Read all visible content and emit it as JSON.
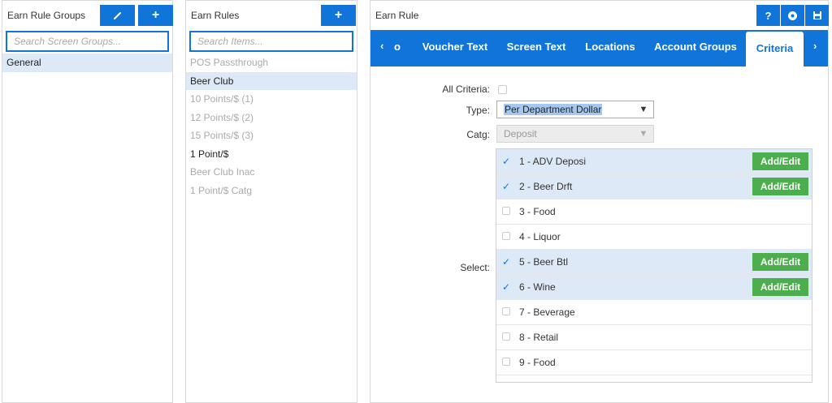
{
  "groups_panel": {
    "title": "Earn Rule Groups",
    "edit_icon": "pencil-icon",
    "add_icon": "plus-icon",
    "search_placeholder": "Search Screen Groups...",
    "items": [
      {
        "label": "General",
        "state": "selected"
      }
    ]
  },
  "rules_panel": {
    "title": "Earn Rules",
    "add_icon": "plus-icon",
    "search_placeholder": "Search Items...",
    "items": [
      {
        "label": "POS Passthrough",
        "state": "inactive"
      },
      {
        "label": "Beer Club",
        "state": "selected"
      },
      {
        "label": "10 Points/$ (1)",
        "state": "inactive"
      },
      {
        "label": "12 Points/$ (2)",
        "state": "inactive"
      },
      {
        "label": "15 Points/$ (3)",
        "state": "inactive"
      },
      {
        "label": "1 Point/$",
        "state": "active"
      },
      {
        "label": "Beer Club Inac",
        "state": "inactive"
      },
      {
        "label": "1 Point/$ Catg",
        "state": "inactive"
      }
    ]
  },
  "earn_rule": {
    "title": "Earn Rule",
    "header_icons": [
      "help-icon",
      "save-disk-icon",
      "save-icon"
    ],
    "help_label": "?",
    "tabs": {
      "partial": "o",
      "voucher_text": "Voucher Text",
      "screen_text": "Screen Text",
      "locations": "Locations",
      "account_groups": "Account Groups",
      "criteria": "Criteria"
    },
    "active_tab": "Criteria",
    "criteria": {
      "all_criteria_label": "All Criteria:",
      "all_criteria_checked": false,
      "type_label": "Type:",
      "type_value": "Per Department Dollar",
      "catg_label": "Catg:",
      "catg_value": "Deposit",
      "select_label": "Select:",
      "add_edit_label": "Add/Edit",
      "items": [
        {
          "label": "1 - ADV Deposi",
          "checked": true
        },
        {
          "label": "2 - Beer Drft",
          "checked": true
        },
        {
          "label": "3 - Food",
          "checked": false
        },
        {
          "label": "4 - Liquor",
          "checked": false
        },
        {
          "label": "5 - Beer Btl",
          "checked": true
        },
        {
          "label": "6 - Wine",
          "checked": true
        },
        {
          "label": "7 - Beverage",
          "checked": false
        },
        {
          "label": "8 - Retail",
          "checked": false
        },
        {
          "label": "9 - Food",
          "checked": false
        }
      ]
    }
  },
  "colors": {
    "primary": "#1074d9",
    "selected_row": "#dde9f6",
    "add_edit_green": "#4cae4c"
  }
}
